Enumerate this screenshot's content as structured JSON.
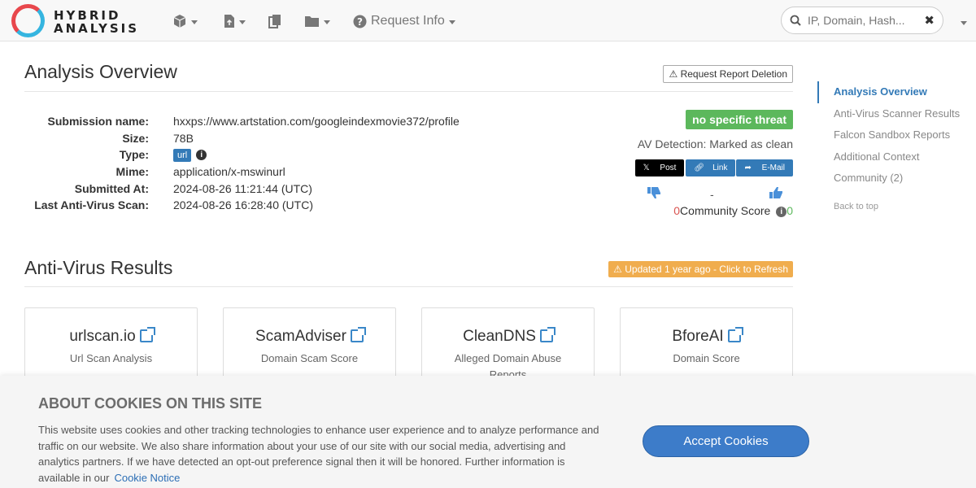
{
  "brand": {
    "line1": "HYBRID",
    "line2": "ANALYSIS"
  },
  "nav": {
    "request_info": "Request Info"
  },
  "search": {
    "placeholder": "IP, Domain, Hash..."
  },
  "overview": {
    "title": "Analysis Overview",
    "delete_btn": "Request Report Deletion",
    "fields": [
      {
        "key": "Submission name:",
        "value": "hxxps://www.artstation.com/googleindexmovie372/profile"
      },
      {
        "key": "Size:",
        "value": "78B"
      },
      {
        "key": "Type:",
        "value": "url"
      },
      {
        "key": "Mime:",
        "value": "application/x-mswinurl"
      },
      {
        "key": "Submitted At:",
        "value": "2024-08-26 11:21:44 (UTC)"
      },
      {
        "key": "Last Anti-Virus Scan:",
        "value": "2024-08-26 16:28:40 (UTC)"
      }
    ],
    "threat": "no specific threat",
    "av_detection": "AV Detection: Marked as clean",
    "share": {
      "post": "Post",
      "link": "Link",
      "email": "E-Mail"
    },
    "vote_dash": "-",
    "community_down": "0",
    "community_label": "Community Score",
    "community_up": "0"
  },
  "av": {
    "title": "Anti-Virus Results",
    "refresh": "Updated 1 year ago - Click to Refresh",
    "cards": [
      {
        "name": "urlscan.io",
        "sub": "Url Scan Analysis"
      },
      {
        "name": "ScamAdviser",
        "sub": "Domain Scam Score"
      },
      {
        "name": "CleanDNS",
        "sub": "Alleged Domain Abuse Reports"
      },
      {
        "name": "BforeAI",
        "sub": "Domain Score"
      }
    ]
  },
  "sidenav": {
    "items": [
      "Analysis Overview",
      "Anti-Virus Scanner Results",
      "Falcon Sandbox Reports",
      "Additional Context",
      "Community (2)"
    ],
    "back": "Back to top"
  },
  "cookie": {
    "title": "ABOUT COOKIES ON THIS SITE",
    "text": "This website uses cookies and other tracking technologies to enhance user experience and to analyze performance and traffic on our website. We also share information about your use of our site with our social media, advertising and analytics partners. If we have detected an opt-out preference signal then it will be honored. Further information is available in our",
    "link": "Cookie Notice",
    "accept": "Accept Cookies"
  },
  "colors": {
    "threat": "#5cb85c",
    "refresh": "#f0ad4e",
    "accent": "#337ab7"
  }
}
